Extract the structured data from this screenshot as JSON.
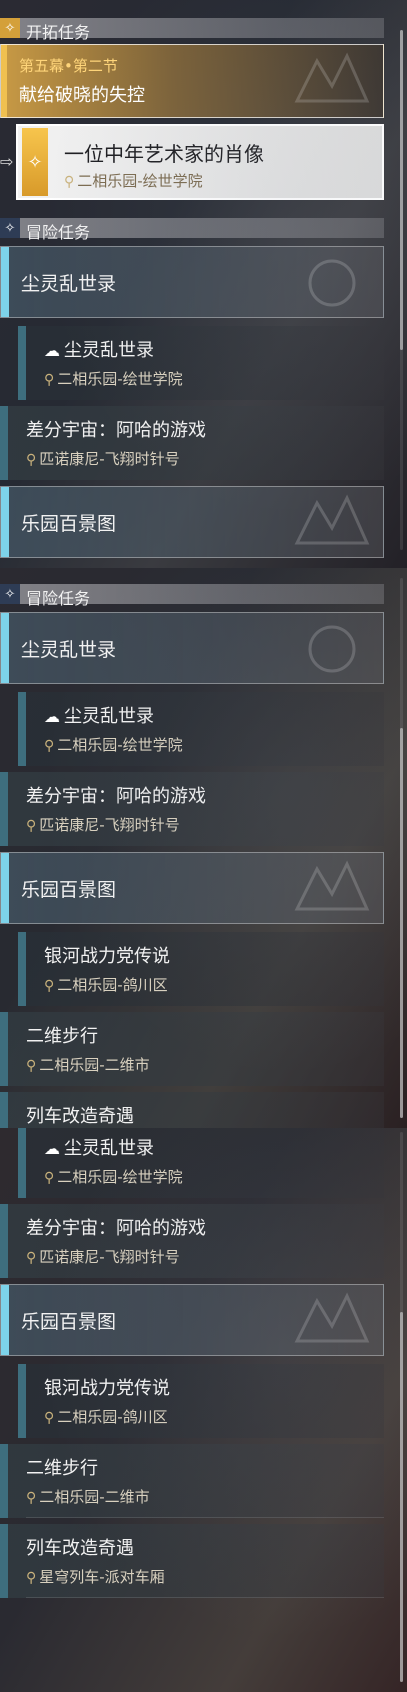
{
  "icons": {
    "section_gold": "✧",
    "section_blue": "✧",
    "pin": "⚲",
    "ghost": "☁",
    "selected_arrow": "⇨"
  },
  "colors": {
    "accent_gold": "#f0c050",
    "accent_cyan": "#7dd3ea",
    "bar_teal": "#3e6e7e",
    "location_text": "#d9d1bf"
  },
  "panel1": {
    "trailblaze_header": "开拓任务",
    "main_quest": {
      "subtitle": "第五幕•第二节",
      "title": "献给破晓的失控"
    },
    "selected_quest": {
      "title": "一位中年艺术家的肖像",
      "location": "二相乐园-绘世学院"
    },
    "adventure_header": "冒险任务",
    "group1": "尘灵乱世录",
    "sub1": {
      "title": "尘灵乱世录",
      "location": "二相乐园-绘世学院"
    },
    "task1": {
      "title": "差分宇宙：阿哈的游戏",
      "location": "匹诺康尼-飞翔时针号"
    },
    "group2": "乐园百景图"
  },
  "panel2": {
    "adventure_header": "冒险任务",
    "group1": "尘灵乱世录",
    "sub1": {
      "title": "尘灵乱世录",
      "location": "二相乐园-绘世学院"
    },
    "task1": {
      "title": "差分宇宙：阿哈的游戏",
      "location": "匹诺康尼-飞翔时针号"
    },
    "group2": "乐园百景图",
    "sub2": {
      "title": "银河战力党传说",
      "location": "二相乐园-鸽川区"
    },
    "task2": {
      "title": "二维步行",
      "location": "二相乐园-二维市"
    },
    "task3_partial": "列车改造奇遇"
  },
  "panel3": {
    "sub1": {
      "title": "尘灵乱世录",
      "location": "二相乐园-绘世学院"
    },
    "task1": {
      "title": "差分宇宙：阿哈的游戏",
      "location": "匹诺康尼-飞翔时针号"
    },
    "group2": "乐园百景图",
    "sub2": {
      "title": "银河战力党传说",
      "location": "二相乐园-鸽川区"
    },
    "task2": {
      "title": "二维步行",
      "location": "二相乐园-二维市"
    },
    "task3": {
      "title": "列车改造奇遇",
      "location": "星穹列车-派对车厢"
    }
  }
}
